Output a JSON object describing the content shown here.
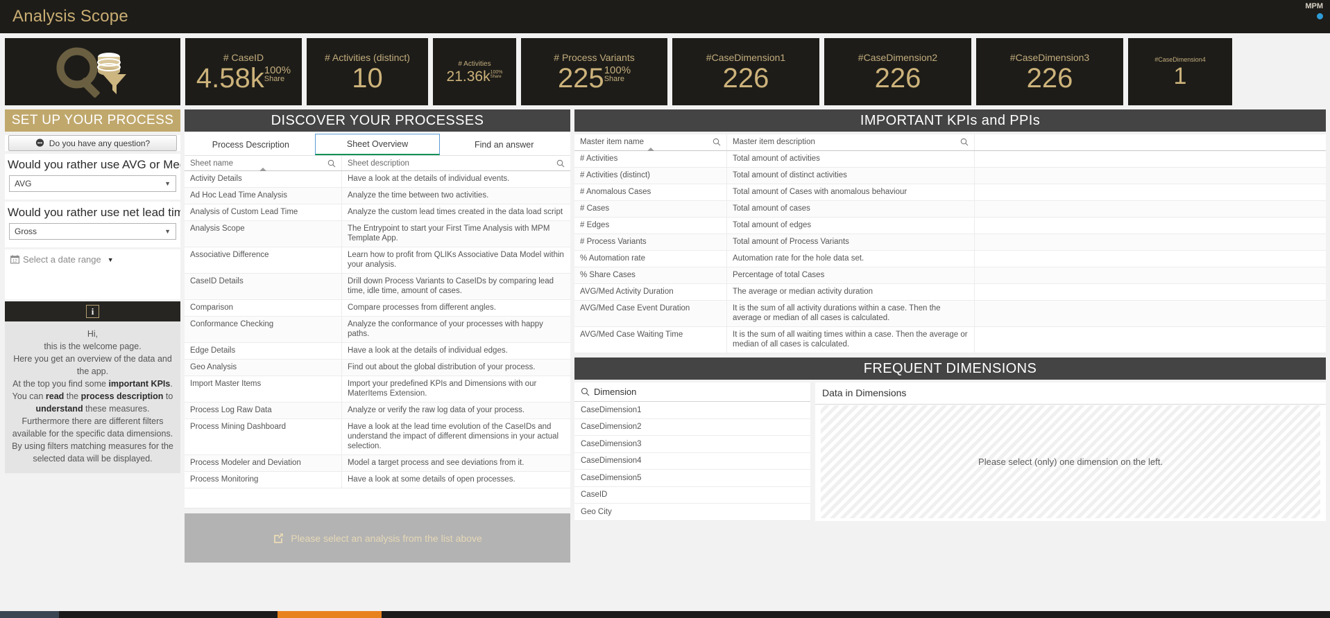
{
  "window": {
    "title": "Analysis Scope",
    "brand_logo": "MPM"
  },
  "kpis": [
    {
      "label": "# CaseID",
      "value": "4.58k",
      "pct": "100%",
      "share_label": "Share",
      "size": "normal"
    },
    {
      "label": "# Activities (distinct)",
      "value": "10",
      "pct": "",
      "share_label": "",
      "size": "normal"
    },
    {
      "label": "# Activities",
      "value": "21.36k",
      "pct": "100%",
      "share_label": "Share",
      "size": "small"
    },
    {
      "label": "# Process Variants",
      "value": "225",
      "pct": "100%",
      "share_label": "Share",
      "size": "normal"
    },
    {
      "label": "#CaseDimension1",
      "value": "226",
      "pct": "",
      "share_label": "",
      "size": "normal"
    },
    {
      "label": "#CaseDimension2",
      "value": "226",
      "pct": "",
      "share_label": "",
      "size": "normal"
    },
    {
      "label": "#CaseDimension3",
      "value": "226",
      "pct": "",
      "share_label": "",
      "size": "normal"
    },
    {
      "label": "#CaseDimension4",
      "value": "1",
      "pct": "",
      "share_label": "",
      "size": "xs"
    }
  ],
  "sidebar": {
    "header": "SET UP YOUR PROCESS",
    "question_button": "Do you have any question?",
    "filters": [
      {
        "question": "Would you rather use AVG or Median?",
        "value": "AVG"
      },
      {
        "question": "Would you rather use net lead time (...",
        "value": "Gross"
      }
    ],
    "date_filter": "Select a date range",
    "info_icon": "i",
    "welcome": {
      "line1": "Hi,",
      "line2": "this is the welcome page.",
      "line3": "Here you get an overview of the data and",
      "line4": "the app.",
      "line5_a": "At the top you find some ",
      "line5_b": "important KPIs",
      "line5_c": ".",
      "line6_a": "You can ",
      "line6_b": "read",
      "line6_c": " the ",
      "line6_d": "process description",
      "line6_e": " to",
      "line7_a": "understand",
      "line7_b": " these measures.",
      "line8": "Furthermore there are different filters",
      "line9": "available for the specific data dimensions.",
      "line10": "By using filters matching measures for the",
      "line11": "selected data will be displayed."
    }
  },
  "center": {
    "header": "DISCOVER YOUR PROCESSES",
    "tabs": [
      {
        "label": "Process Description",
        "active": false
      },
      {
        "label": "Sheet Overview",
        "active": true
      },
      {
        "label": "Find an answer",
        "active": false
      }
    ],
    "columns": [
      "Sheet name",
      "Sheet description"
    ],
    "rows": [
      {
        "name": "Activity Details",
        "desc": "Have a look at the details of individual events."
      },
      {
        "name": "Ad Hoc Lead Time Analysis",
        "desc": "Analyze the time between two activities."
      },
      {
        "name": "Analysis of Custom Lead Time",
        "desc": "Analyze the custom lead times created in the data load script"
      },
      {
        "name": "Analysis Scope",
        "desc": "The Entrypoint to start your First Time Analysis with MPM Template App."
      },
      {
        "name": "Associative Difference",
        "desc": "Learn how to profit from QLIKs Associative Data Model within your analysis."
      },
      {
        "name": "CaseID Details",
        "desc": "Drill down Process Variants to CaseIDs by comparing lead time, idle time, amount of cases."
      },
      {
        "name": "Comparison",
        "desc": "Compare processes from different angles."
      },
      {
        "name": "Conformance Checking",
        "desc": "Analyze the conformance of your processes with happy paths."
      },
      {
        "name": "Edge Details",
        "desc": "Have a look at the details of individual edges."
      },
      {
        "name": "Geo Analysis",
        "desc": "Find out about the global distribution of your process."
      },
      {
        "name": "Import Master Items",
        "desc": "Import your predefined KPIs and Dimensions with our MaterItems Extension."
      },
      {
        "name": "Process Log Raw Data",
        "desc": "Analyze or verify the raw log data of your process."
      },
      {
        "name": "Process Mining Dashboard",
        "desc": "Have a look at the lead time evolution of the CaseIDs and understand the impact of different dimensions in your actual selection."
      },
      {
        "name": "Process Modeler and Deviation",
        "desc": "Model a target process and see deviations from it."
      },
      {
        "name": "Process Monitoring",
        "desc": "Have a look at some details of open processes."
      }
    ],
    "select_banner": "Please select an analysis from the list above"
  },
  "kpi_panel": {
    "header": "IMPORTANT KPIs and PPIs",
    "columns": [
      "Master item name",
      "Master item description",
      ""
    ],
    "rows": [
      {
        "name": "# Activities",
        "desc": "Total amount of activities"
      },
      {
        "name": "# Activities (distinct)",
        "desc": "Total amount of distinct activities"
      },
      {
        "name": "# Anomalous Cases",
        "desc": "Total amount of Cases with anomalous behaviour"
      },
      {
        "name": "# Cases",
        "desc": "Total amount of cases"
      },
      {
        "name": "# Edges",
        "desc": "Total amount of edges"
      },
      {
        "name": "# Process Variants",
        "desc": "Total amount of Process Variants"
      },
      {
        "name": "% Automation rate",
        "desc": "Automation rate for the hole data set."
      },
      {
        "name": "% Share Cases",
        "desc": "Percentage of total Cases"
      },
      {
        "name": "AVG/Med Activity Duration",
        "desc": "The average or median activity duration"
      },
      {
        "name": "AVG/Med Case Event Duration",
        "desc": "It is the sum of all activity durations within a case. Then the average or median of all cases is calculated."
      },
      {
        "name": "AVG/Med Case Waiting Time",
        "desc": "It is the sum of all waiting times within a case. Then the average or median of all cases is calculated."
      }
    ]
  },
  "frequent_dimensions": {
    "header": "FREQUENT DIMENSIONS",
    "list_title": "Dimension",
    "items": [
      "CaseDimension1",
      "CaseDimension2",
      "CaseDimension3",
      "CaseDimension4",
      "CaseDimension5",
      "CaseID",
      "Geo City"
    ],
    "panel_title": "Data in Dimensions",
    "panel_placeholder": "Please select (only) one dimension on the left."
  }
}
